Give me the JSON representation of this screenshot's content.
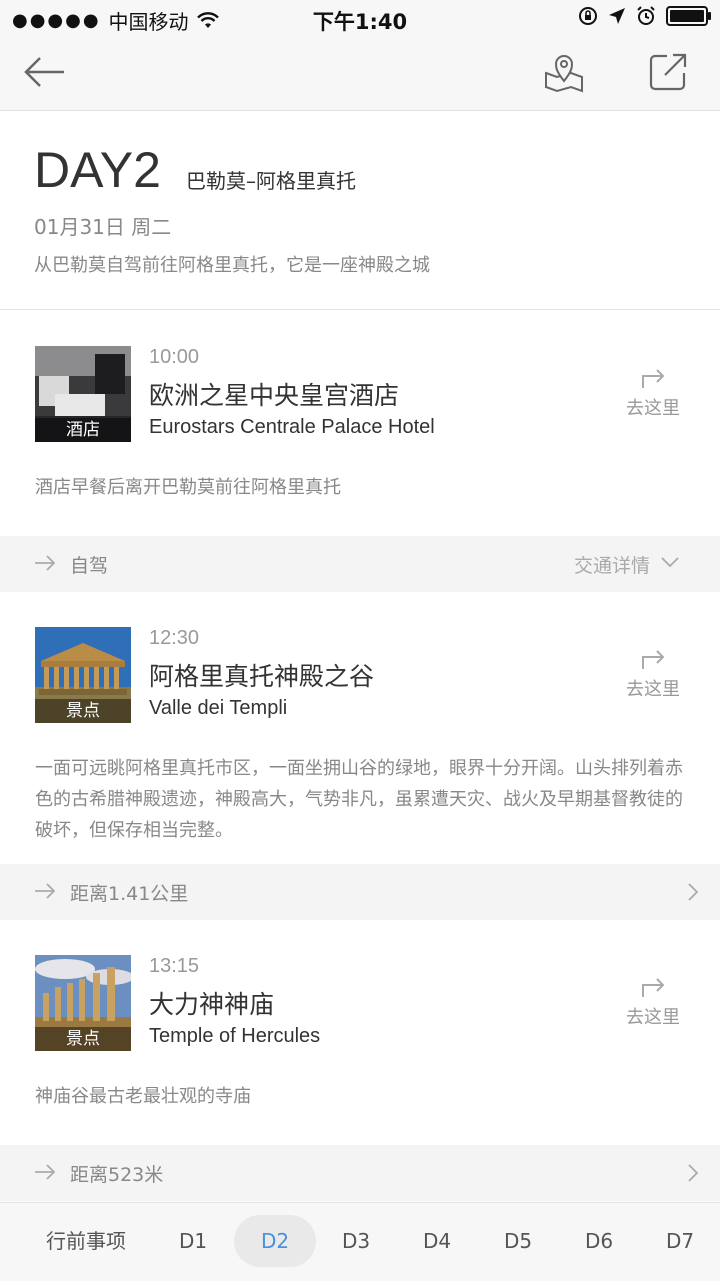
{
  "status": {
    "carrier": "中国移动",
    "time": "下午1:40",
    "signal_dots": "●●●●●"
  },
  "header": {
    "day": "DAY2",
    "route": "巴勒莫–阿格里真托",
    "date": "01月31日 周二",
    "description": "从巴勒莫自驾前往阿格里真托，它是一座神殿之城"
  },
  "items": [
    {
      "time": "10:00",
      "cn_name": "欧洲之星中央皇宫酒店",
      "en_name": "Eurostars Centrale Palace Hotel",
      "tag": "酒店",
      "goto": "去这里",
      "desc": "酒店早餐后离开巴勒莫前往阿格里真托"
    },
    {
      "time": "12:30",
      "cn_name": "阿格里真托神殿之谷",
      "en_name": "Valle dei Templi",
      "tag": "景点",
      "goto": "去这里",
      "desc": "一面可远眺阿格里真托市区，一面坐拥山谷的绿地，眼界十分开阔。山头排列着赤色的古希腊神殿遗迹，神殿高大，气势非凡，虽累遭天灾、战火及早期基督教徒的破坏，但保存相当完整。"
    },
    {
      "time": "13:15",
      "cn_name": "大力神神庙",
      "en_name": "Temple of Hercules",
      "tag": "景点",
      "goto": "去这里",
      "desc": "神庙谷最古老最壮观的寺庙"
    }
  ],
  "transits": [
    {
      "label": "自驾",
      "detail": "交通详情"
    },
    {
      "label": "距离1.41公里"
    },
    {
      "label": "距离523米"
    }
  ],
  "tabs": [
    "行前事项",
    "D1",
    "D2",
    "D3",
    "D4",
    "D5",
    "D6",
    "D7"
  ],
  "colors": {
    "accent": "#4a90e2",
    "text_secondary": "#888888",
    "divider_bg": "#f4f4f4"
  }
}
